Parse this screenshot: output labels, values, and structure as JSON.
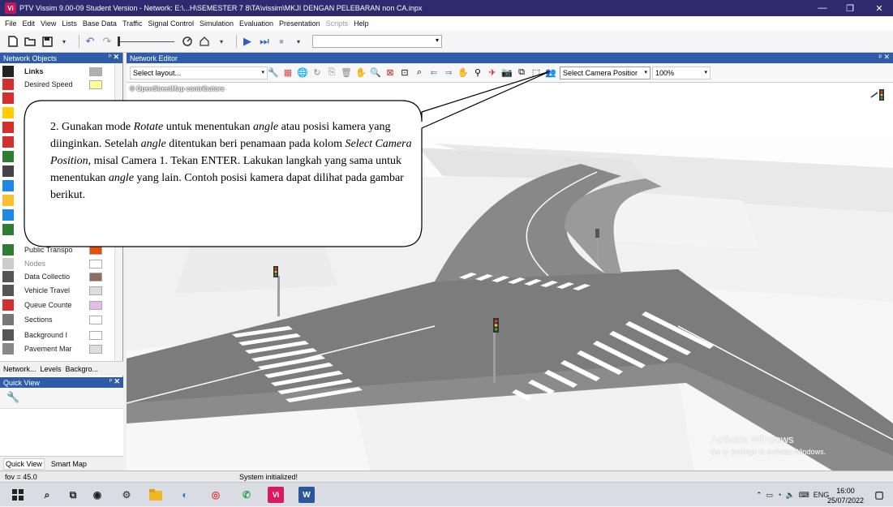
{
  "window": {
    "app_icon_text": "Vi",
    "title": "PTV Vissim 9.00-09 Student Version - Network: E:\\...H\\SEMESTER 7 8\\TA\\vissim\\MKJI DENGAN PELEBARAN non CA.inpx",
    "controls": {
      "minimize": "—",
      "restore": "❐",
      "close": "✕"
    }
  },
  "menu": {
    "items": [
      "File",
      "Edit",
      "View",
      "Lists",
      "Base Data",
      "Traffic",
      "Signal Control",
      "Simulation",
      "Evaluation",
      "Presentation"
    ],
    "disabled_item": "Scripts",
    "help": "Help"
  },
  "toolbar": {
    "icons": [
      "new-icon",
      "open-icon",
      "save-icon",
      "undo-icon",
      "redo-icon",
      "speed-slider",
      "step-icon",
      "home-icon",
      "play-icon",
      "play-step-icon",
      "stop-icon"
    ]
  },
  "network_objects": {
    "title": "Network Objects",
    "pin": "ᵖ",
    "close": "✕",
    "items": [
      {
        "label": "Links",
        "bold": true,
        "icon": "links-icon",
        "color": "#222222",
        "swatch": "#b0b0b0"
      },
      {
        "label": "Desired Speed",
        "icon": "desired-speed-icon",
        "color": "#d32f2f",
        "swatch": "#ffff99"
      },
      {
        "label": "Public Transpo",
        "icon": "public-transport-stop-icon",
        "color": "#2e7d32",
        "swatch": "#e65100"
      },
      {
        "label": "Nodes",
        "dim": true,
        "icon": "nodes-icon",
        "color": "#cccccc",
        "swatch": "#ffffff"
      },
      {
        "label": "Data Collectio",
        "icon": "data-collection-icon",
        "color": "#555555",
        "swatch": "#8d6e63"
      },
      {
        "label": "Vehicle Travel",
        "icon": "vehicle-travel-icon",
        "color": "#555555",
        "swatch": "#dddddd"
      },
      {
        "label": "Queue Counte",
        "icon": "queue-counter-icon",
        "color": "#d32f2f",
        "swatch": "#e1bee7"
      },
      {
        "label": "Sections",
        "icon": "sections-icon",
        "color": "#777777",
        "swatch": "#ffffff"
      },
      {
        "label": "Background I",
        "icon": "background-image-icon",
        "color": "#555555",
        "swatch": "#ffffff"
      },
      {
        "label": "Pavement Mar",
        "icon": "pavement-marking-icon",
        "color": "#888888",
        "swatch": "#dddddd"
      }
    ],
    "tabs": [
      "Network...",
      "Levels",
      "Backgro..."
    ]
  },
  "quick_view": {
    "title": "Quick View",
    "tool_icon": "wrench-icon",
    "tabs": [
      "Quick View",
      "Smart Map"
    ]
  },
  "editor": {
    "title": "Network Editor",
    "pin": "ᵖ ✕",
    "layout_combo": "Select layout...",
    "camera_combo": "Select Camera Positior",
    "zoom_combo": "100%",
    "osm_credit": "© OpenStreetMap contributors"
  },
  "callout": {
    "text_parts": [
      {
        "t": "2. Gunakan mode "
      },
      {
        "t": "Rotate",
        "i": true
      },
      {
        "t": " untuk menentukan "
      },
      {
        "t": "angle",
        "i": true
      },
      {
        "t": " atau posisi kamera yang diinginkan. Setelah "
      },
      {
        "t": "angle",
        "i": true
      },
      {
        "t": " ditentukan beri penamaan pada kolom "
      },
      {
        "t": "Select Camera Position",
        "i": true
      },
      {
        "t": ", misal Camera 1. Tekan ENTER. Lakukan langkah yang sama untuk menentukan "
      },
      {
        "t": "angle",
        "i": true
      },
      {
        "t": " yang lain. Contoh posisi kamera dapat dilihat pada gambar berikut."
      }
    ]
  },
  "watermark": {
    "line1": "Activate Windows",
    "line2": "Go to Settings to activate Windows."
  },
  "status": {
    "fov": "fov = 45.0",
    "message": "System initialized!"
  },
  "taskbar": {
    "apps": [
      "windows-start-icon",
      "search-icon",
      "task-view-icon",
      "vissim-app-icon",
      "settings-icon",
      "file-explorer-icon",
      "edge-icon",
      "chrome-icon",
      "whatsapp-icon",
      "vissim-running-icon",
      "word-icon"
    ],
    "tray_lang": "ENG",
    "time": "16:00",
    "date": "25/07/2022"
  }
}
